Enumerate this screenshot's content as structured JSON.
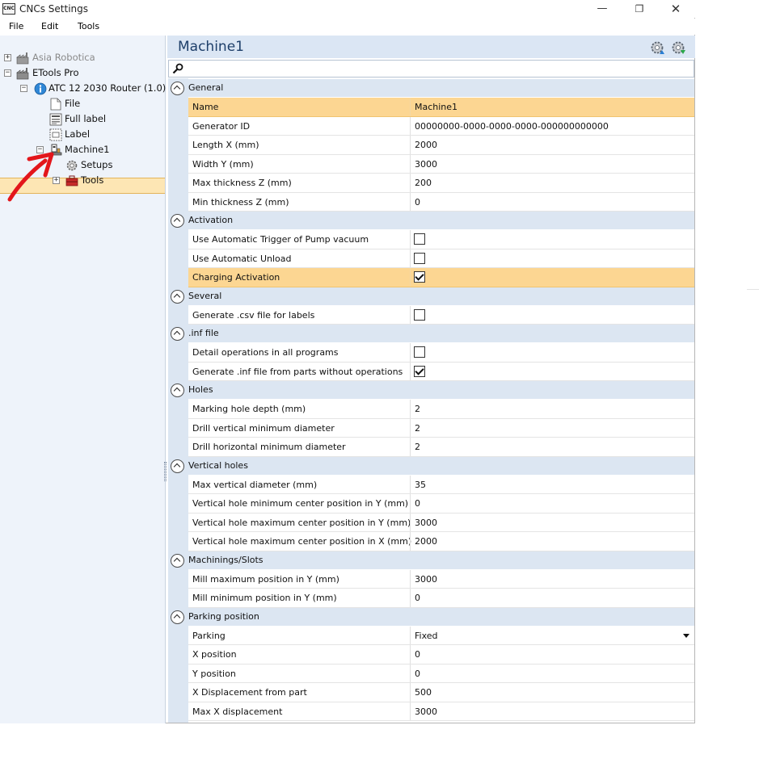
{
  "window": {
    "app_icon_text": "CNC",
    "title": "CNCs Settings",
    "minimize": "—",
    "maximize": "❐",
    "close": "✕"
  },
  "menu": [
    "File",
    "Edit",
    "Tools"
  ],
  "tree": {
    "nodes": [
      {
        "label": "Asia Robotica",
        "expander": "+",
        "icon": "factory-icon"
      },
      {
        "label": "ETools Pro",
        "expander": "−",
        "icon": "factory-icon"
      },
      {
        "label": "ATC 12 2030 Router (1.0)",
        "expander": "−",
        "icon": "info-globe-icon"
      },
      {
        "label": "File",
        "icon": "file-icon"
      },
      {
        "label": "Full label",
        "icon": "full-label-icon"
      },
      {
        "label": "Label",
        "icon": "label-icon"
      },
      {
        "label": "Machine1",
        "expander": "−",
        "icon": "machine-icon",
        "selected": true
      },
      {
        "label": "Setups",
        "icon": "gear-icon"
      },
      {
        "label": "Tools",
        "expander": "+",
        "icon": "toolbox-icon"
      }
    ]
  },
  "panel": {
    "title": "Machine1",
    "header_icons": [
      "upload-settings-icon",
      "download-settings-icon"
    ]
  },
  "grid": {
    "categories": [
      {
        "name": "General",
        "rows": [
          {
            "name": "Name",
            "value": "Machine1",
            "highlight": true
          },
          {
            "name": "Generator ID",
            "value": "00000000-0000-0000-0000-000000000000"
          },
          {
            "name": "Length X (mm)",
            "value": "2000"
          },
          {
            "name": "Width Y (mm)",
            "value": "3000"
          },
          {
            "name": "Max thickness Z (mm)",
            "value": "200"
          },
          {
            "name": "Min thickness Z (mm)",
            "value": "0"
          }
        ]
      },
      {
        "name": "Activation",
        "rows": [
          {
            "name": "Use Automatic Trigger of Pump vacuum",
            "checkbox": false
          },
          {
            "name": "Use Automatic Unload",
            "checkbox": false
          },
          {
            "name": "Charging Activation",
            "checkbox": true,
            "highlight": true
          }
        ]
      },
      {
        "name": "Several",
        "rows": [
          {
            "name": "Generate .csv file for labels",
            "checkbox": false
          }
        ]
      },
      {
        "name": ".inf file",
        "rows": [
          {
            "name": "Detail operations in all programs",
            "checkbox": false
          },
          {
            "name": "Generate .inf file from parts without operations",
            "checkbox": true
          }
        ]
      },
      {
        "name": "Holes",
        "rows": [
          {
            "name": "Marking hole depth (mm)",
            "value": "2"
          },
          {
            "name": "Drill vertical minimum diameter",
            "value": "2"
          },
          {
            "name": "Drill horizontal minimum diameter",
            "value": "2"
          }
        ]
      },
      {
        "name": "Vertical holes",
        "rows": [
          {
            "name": "Max vertical diameter (mm)",
            "value": "35"
          },
          {
            "name": "Vertical hole minimum center position in Y (mm)",
            "value": "0"
          },
          {
            "name": "Vertical hole maximum center position in Y (mm)",
            "value": "3000"
          },
          {
            "name": "Vertical hole maximum center position in X (mm)",
            "value": "2000"
          }
        ]
      },
      {
        "name": "Machinings/Slots",
        "rows": [
          {
            "name": "Mill maximum position in Y (mm)",
            "value": "3000"
          },
          {
            "name": "Mill minimum position in Y (mm)",
            "value": "0"
          }
        ]
      },
      {
        "name": "Parking position",
        "rows": [
          {
            "name": "Parking",
            "value": "Fixed",
            "dropdown": true
          },
          {
            "name": "X position",
            "value": "0"
          },
          {
            "name": "Y position",
            "value": "0"
          },
          {
            "name": "X Displacement from part",
            "value": "500"
          },
          {
            "name": "Max X displacement",
            "value": "3000"
          }
        ]
      }
    ]
  },
  "colors": {
    "highlight": "#fcd692",
    "selection": "#fde6b4",
    "category_band": "#dce6f2",
    "annotation_arrow": "#e3161b"
  }
}
